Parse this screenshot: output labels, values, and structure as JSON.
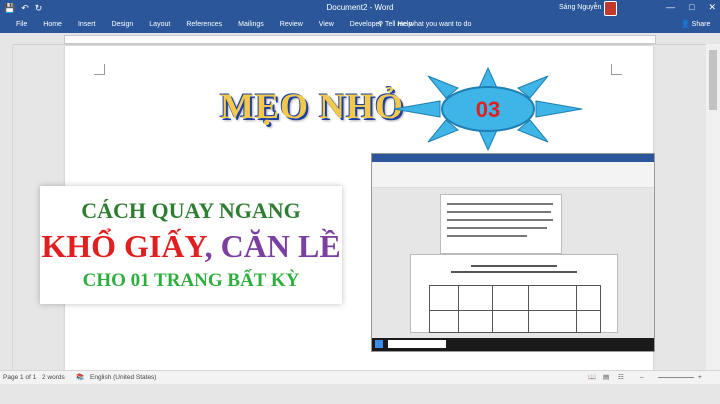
{
  "titlebar": {
    "title": "Document2 - Word",
    "user": "Sáng Nguyễn",
    "save_icon": "save-icon",
    "undo_icon": "undo-icon",
    "redo_icon": "redo-icon",
    "minimize": "—",
    "maximize": "□",
    "close": "✕"
  },
  "ribbon": {
    "tabs": [
      "File",
      "Home",
      "Insert",
      "Design",
      "Layout",
      "References",
      "Mailings",
      "Review",
      "View",
      "Developer",
      "Help"
    ],
    "tell_me": "Tell me what you want to do",
    "share": "Share"
  },
  "thumbnail": {
    "heading": "MẸO NHỎ",
    "badge": "03",
    "line1": "CÁCH QUAY NGANG",
    "line2_red": "KHỔ GIẤY",
    "line2_sep": ", ",
    "line2_purple": "CĂN LỀ",
    "line3": "CHO 01 TRANG BẤT KỲ",
    "colors": {
      "sun": "#3fb4e6",
      "badge_text": "#e02020",
      "heading": "#f2c94c"
    }
  },
  "statusbar": {
    "page": "Page 1 of 1",
    "words": "2 words",
    "language": "English (United States)",
    "zoom_out": "–",
    "zoom_in": "+"
  }
}
